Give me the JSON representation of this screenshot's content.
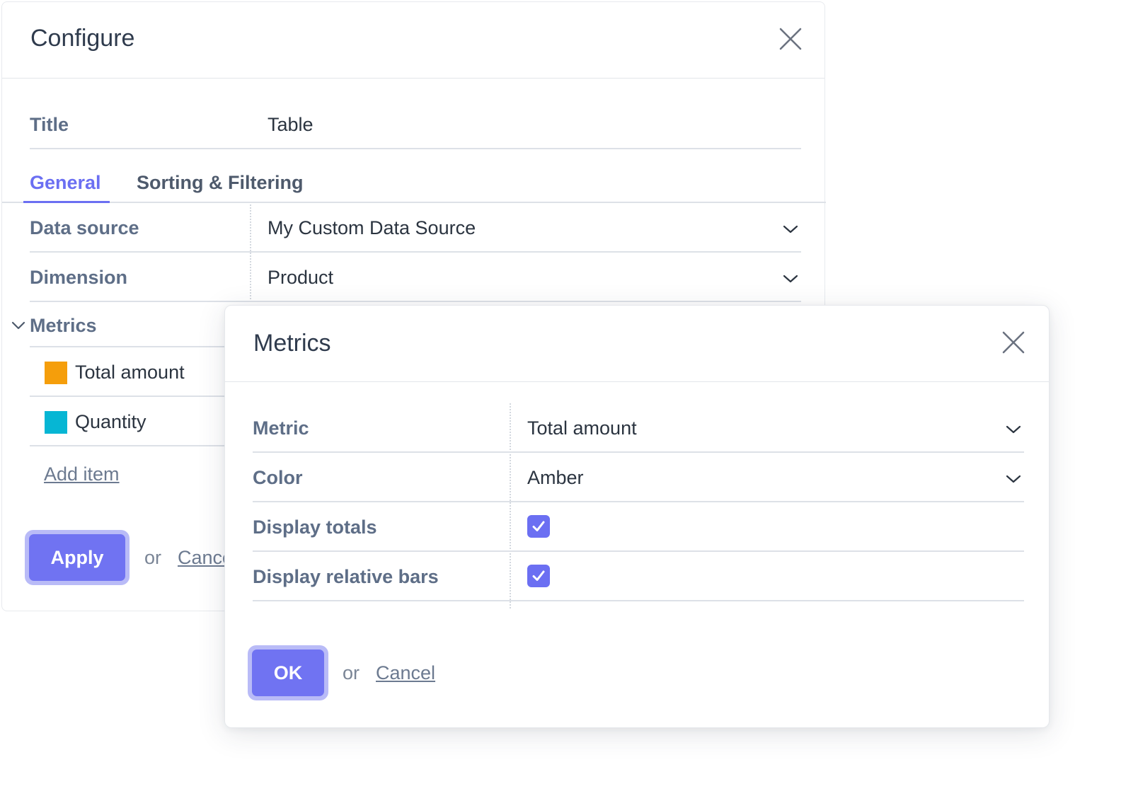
{
  "configure": {
    "title": "Configure",
    "title_field": {
      "label": "Title",
      "value": "Table"
    },
    "tabs": [
      {
        "label": "General",
        "active": true
      },
      {
        "label": "Sorting & Filtering",
        "active": false
      }
    ],
    "data_source": {
      "label": "Data source",
      "value": "My Custom Data Source"
    },
    "dimension": {
      "label": "Dimension",
      "value": "Product"
    },
    "metrics_section": {
      "label": "Metrics",
      "items": [
        {
          "label": "Total amount",
          "color": "#f59e0b"
        },
        {
          "label": "Quantity",
          "color": "#06b6d4"
        }
      ],
      "add_item": "Add item"
    },
    "apply_label": "Apply",
    "or_text": "or",
    "cancel_label": "Cancel"
  },
  "metrics_dialog": {
    "title": "Metrics",
    "metric": {
      "label": "Metric",
      "value": "Total amount"
    },
    "color": {
      "label": "Color",
      "value": "Amber"
    },
    "display_totals": {
      "label": "Display totals",
      "checked": true
    },
    "display_relative_bars": {
      "label": "Display relative bars",
      "checked": true
    },
    "ok_label": "OK",
    "or_text": "or",
    "cancel_label": "Cancel"
  },
  "colors": {
    "accent": "#6b6ff2",
    "button": "#7073f2",
    "label": "#5e6e87"
  },
  "icons": [
    "close-icon",
    "chevron-down-icon",
    "check-icon"
  ]
}
